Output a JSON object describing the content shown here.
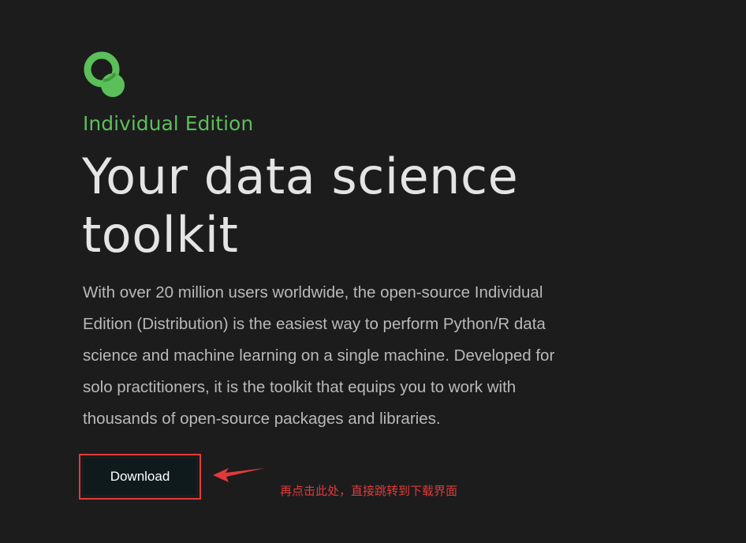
{
  "hero": {
    "logo_icon": "anaconda-ring-icon",
    "edition_label": "Individual Edition",
    "headline_line1": "Your data science",
    "headline_line2": "toolkit",
    "description_lines": [
      "With over 20 million users worldwide, the open-source Individual",
      "Edition (Distribution) is the easiest way to perform Python/R data",
      "science and machine learning on a single machine. Developed for",
      "solo practitioners, it is the toolkit that equips you to work with",
      "thousands of open-source packages and libraries."
    ],
    "download_label": "Download"
  },
  "annotation": {
    "text": "再点击此处，直接跳转到下载界面",
    "color": "#e23a3a",
    "arrow_icon": "left-arrow-icon"
  },
  "colors": {
    "background": "#1c1c1d",
    "accent_green": "#5bbf5a",
    "headline": "#e4e4e4",
    "body_text": "#b9b9b9",
    "button_bg": "#0f1a1d"
  }
}
